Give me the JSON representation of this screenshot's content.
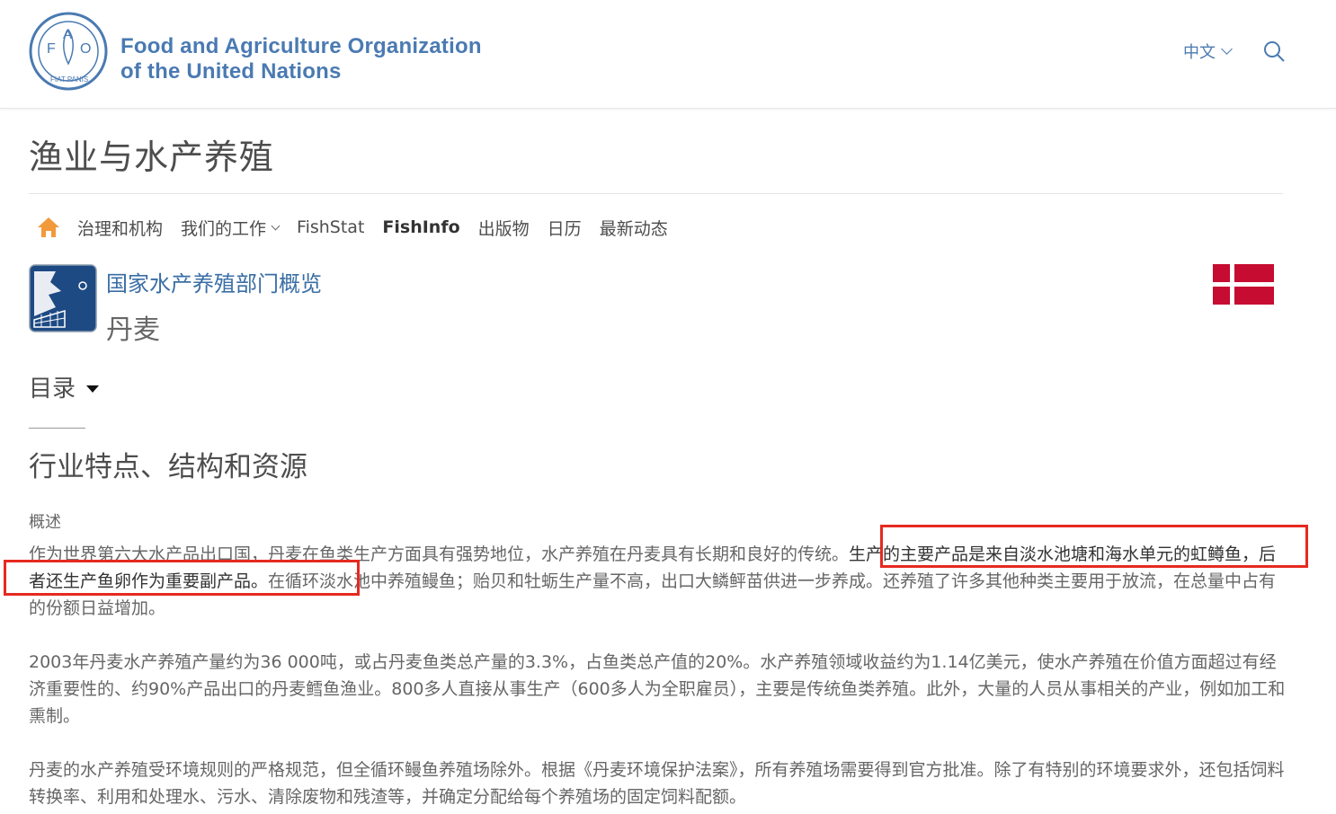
{
  "header": {
    "org_line1": "Food and Agriculture Organization",
    "org_line2": "of the United Nations",
    "logo_letters": [
      "F",
      "A",
      "O"
    ],
    "logo_motto": "FIAT PANIS",
    "language": "中文",
    "search_icon": "search-icon",
    "accent_color": "#4a7ab2"
  },
  "page_title": "渔业与水产养殖",
  "nav": {
    "home_icon": "home-icon",
    "items": [
      {
        "label": "治理和机构"
      },
      {
        "label": "我们的工作"
      },
      {
        "label": "FishStat"
      },
      {
        "label": "FishInfo"
      },
      {
        "label": "出版物"
      },
      {
        "label": "日历"
      },
      {
        "label": "最新动态"
      }
    ]
  },
  "profile": {
    "link": "国家水产养殖部门概览",
    "country": "丹麦",
    "flag_colors": [
      "#c60c30",
      "#ffffff"
    ]
  },
  "toc": {
    "label": "目录"
  },
  "content": {
    "heading": "行业特点、结构和资源",
    "sub_label": "概述",
    "p1_a": "作为世界第六大水产品出口国，丹麦在鱼类生产方面具有强势地位，水产养殖在丹麦具有长期和良好的传统。",
    "p1_b": "生产的主要产品是来自淡水池塘和海水单元的虹鳟鱼，后者还生产鱼卵作为重要副产品。",
    "p1_c": "在循环淡水池中养殖鳗鱼；贻贝和牡蛎生产量不高，出口大鳞鲆苗供进一步养成。还养殖了许多其他种类主要用于放流，在总量中占有的份额日益增加。",
    "p2": "2003年丹麦水产养殖产量约为36 000吨，或占丹麦鱼类总产量的3.3%，占鱼类总产值的20%。水产养殖领域收益约为1.14亿美元，使水产养殖在价值方面超过有经济重要性的、约90%产品出口的丹麦鳕鱼渔业。800多人直接从事生产（600多人为全职雇员），主要是传统鱼类养殖。此外，大量的人员从事相关的产业，例如加工和熏制。",
    "p3": "丹麦的水产养殖受环境规则的严格规范，但全循环鳗鱼养殖场除外。根据《丹麦环境保护法案》，所有养殖场需要得到官方批准。除了有特别的环境要求外，还包括饲料转换率、利用和处理水、污水、清除废物和残渣等，并确定分配给每个养殖场的固定饲料配额。"
  },
  "annotation_color": "#e6291f"
}
